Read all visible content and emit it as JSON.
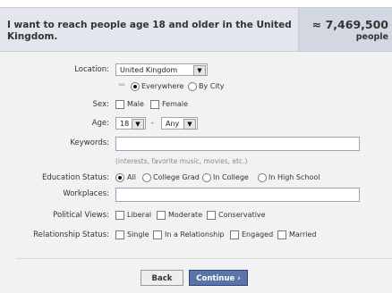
{
  "header": {
    "description": "I want to reach people age 18 and older in the United Kingdom.",
    "reach_count": "≈ 7,469,500",
    "reach_unit": "people"
  },
  "location": {
    "label": "Location:",
    "selected": "United Kingdom",
    "scope_options": [
      "Everywhere",
      "By City"
    ],
    "selected_scope": "Everywhere"
  },
  "sex": {
    "label": "Sex:",
    "options": [
      "Male",
      "Female"
    ]
  },
  "age": {
    "label": "Age:",
    "min": "18",
    "separator": "-",
    "max": "Any"
  },
  "keywords": {
    "label": "Keywords:",
    "value": "",
    "hint": "(interests, favorite music, movies, etc.)"
  },
  "education": {
    "label": "Education Status:",
    "options": [
      "All",
      "College Grad",
      "In College",
      "In High School"
    ],
    "selected": "All"
  },
  "workplaces": {
    "label": "Workplaces:",
    "value": ""
  },
  "political": {
    "label": "Political Views:",
    "options": [
      "Liberal",
      "Moderate",
      "Conservative"
    ]
  },
  "relationship": {
    "label": "Relationship Status:",
    "options": [
      "Single",
      "In a Relationship",
      "Engaged",
      "Married"
    ]
  },
  "buttons": {
    "back": "Back",
    "continue": "Continue ›"
  },
  "colors": {
    "header_bg": "#e3e6ec",
    "reach_bg": "#d2d7e2",
    "primary_button": "#5b74a8"
  }
}
